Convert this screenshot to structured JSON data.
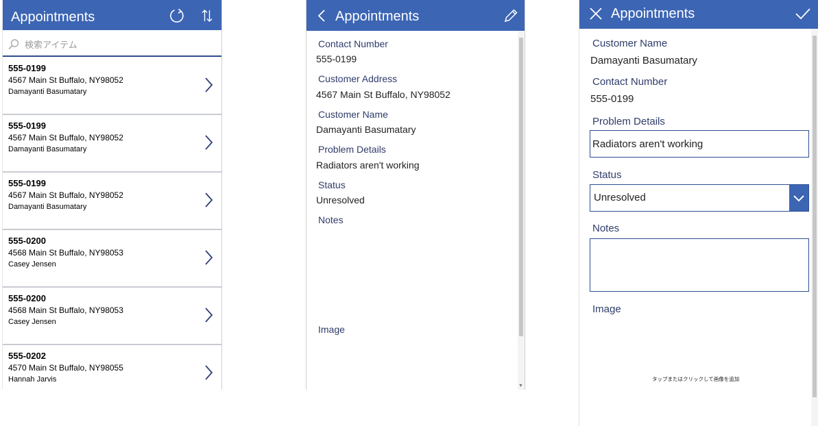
{
  "browse": {
    "title": "Appointments",
    "refresh_icon": "refresh-icon",
    "sort_icon": "sort-icon",
    "search": {
      "placeholder": "検索アイテム",
      "value": ""
    },
    "items": [
      {
        "phone": "555-0199",
        "address": "4567 Main St Buffalo, NY98052",
        "name": "Damayanti Basumatary"
      },
      {
        "phone": "555-0199",
        "address": "4567 Main St Buffalo, NY98052",
        "name": "Damayanti Basumatary"
      },
      {
        "phone": "555-0199",
        "address": "4567 Main St Buffalo, NY98052",
        "name": "Damayanti Basumatary"
      },
      {
        "phone": "555-0200",
        "address": "4568 Main St Buffalo, NY98053",
        "name": "Casey Jensen"
      },
      {
        "phone": "555-0200",
        "address": "4568 Main St Buffalo, NY98053",
        "name": "Casey Jensen"
      },
      {
        "phone": "555-0202",
        "address": "4570 Main St Buffalo, NY98055",
        "name": "Hannah Jarvis"
      }
    ]
  },
  "detail": {
    "title": "Appointments",
    "back_icon": "back-icon",
    "edit_icon": "pencil-icon",
    "fields": {
      "contact_label": "Contact Number",
      "contact_value": "555-0199",
      "address_label": "Customer Address",
      "address_value": "4567 Main St Buffalo, NY98052",
      "name_label": "Customer Name",
      "name_value": "Damayanti Basumatary",
      "problem_label": "Problem Details",
      "problem_value": "Radiators aren't working",
      "status_label": "Status",
      "status_value": "Unresolved",
      "notes_label": "Notes",
      "image_label": "Image"
    }
  },
  "edit": {
    "title": "Appointments",
    "close_icon": "close-icon",
    "save_icon": "checkmark-icon",
    "fields": {
      "name_label": "Customer Name",
      "name_value": "Damayanti Basumatary",
      "contact_label": "Contact Number",
      "contact_value": "555-0199",
      "problem_label": "Problem Details",
      "problem_value": "Radiators aren't working",
      "status_label": "Status",
      "status_value": "Unresolved",
      "notes_label": "Notes",
      "notes_value": "",
      "image_label": "Image",
      "image_hint": "タップまたはクリックして画像を追加"
    }
  },
  "colors": {
    "header": "#3c65b4",
    "label": "#2f3c6b",
    "divider": "#c9cbd2",
    "input_border": "#2e4d8f"
  }
}
